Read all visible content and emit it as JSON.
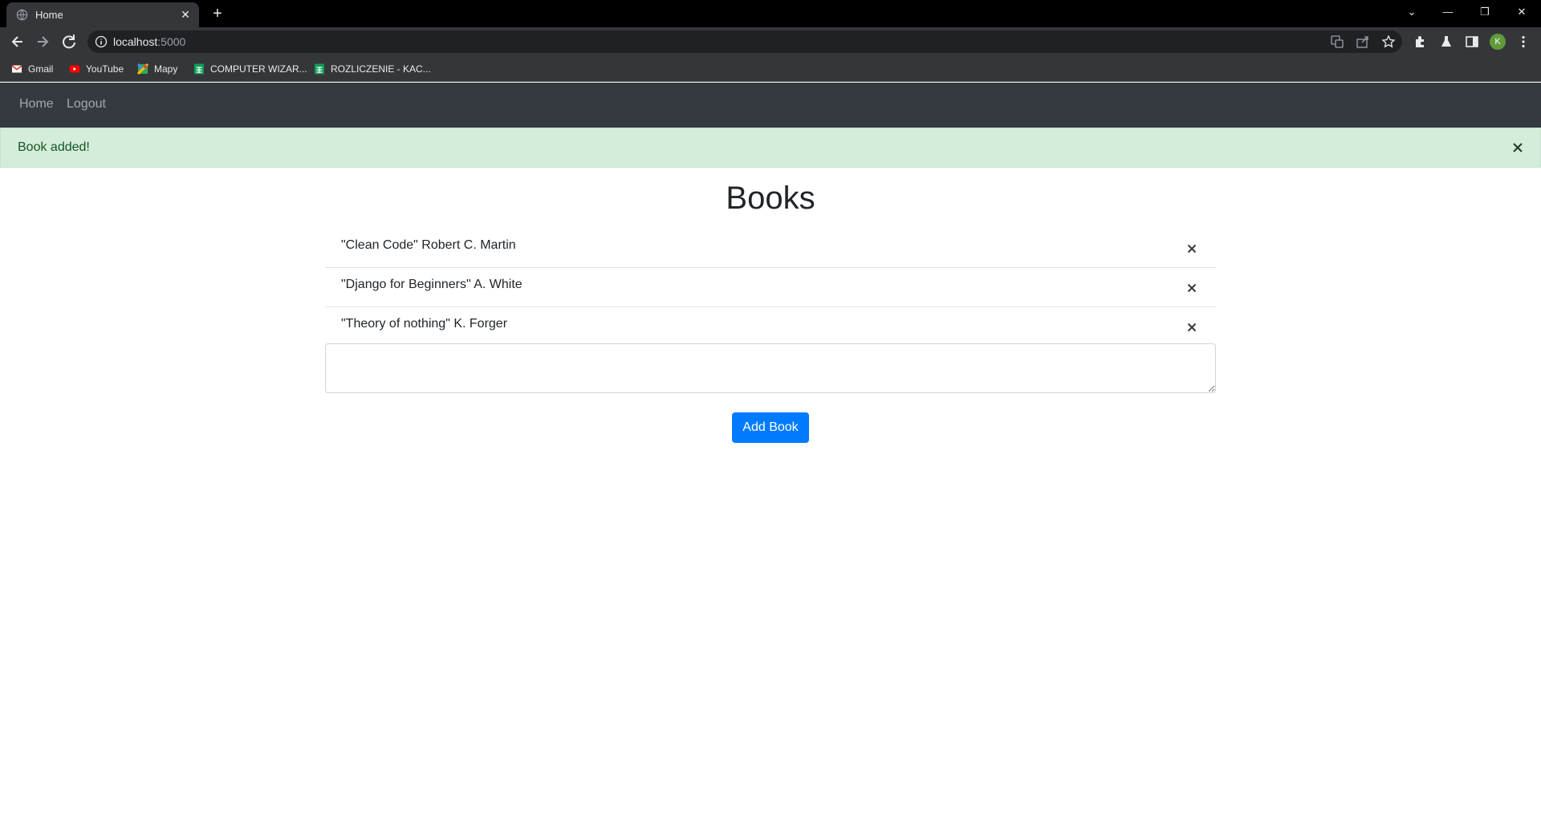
{
  "browser": {
    "tab_title": "Home",
    "url_host": "localhost",
    "url_port": ":5000",
    "profile_initial": "K",
    "bookmarks": [
      {
        "label": "Gmail",
        "icon": "gmail-icon"
      },
      {
        "label": "YouTube",
        "icon": "youtube-icon"
      },
      {
        "label": "Mapy",
        "icon": "maps-icon"
      },
      {
        "label": "COMPUTER WIZAR...",
        "icon": "sheets-icon"
      },
      {
        "label": "ROZLICZENIE - KAC...",
        "icon": "sheets-icon"
      }
    ]
  },
  "nav": {
    "home": "Home",
    "logout": "Logout"
  },
  "alert": {
    "message": "Book added!"
  },
  "page": {
    "title": "Books",
    "books": [
      "\"Clean Code\" Robert C. Martin",
      "\"Django for Beginners\" A. White",
      "\"Theory of nothing\" K. Forger"
    ],
    "input_value": "",
    "add_button": "Add Book"
  },
  "colors": {
    "navbar": "#343a40",
    "alert_bg": "#d4edda",
    "alert_text": "#155724",
    "primary": "#007bff"
  }
}
